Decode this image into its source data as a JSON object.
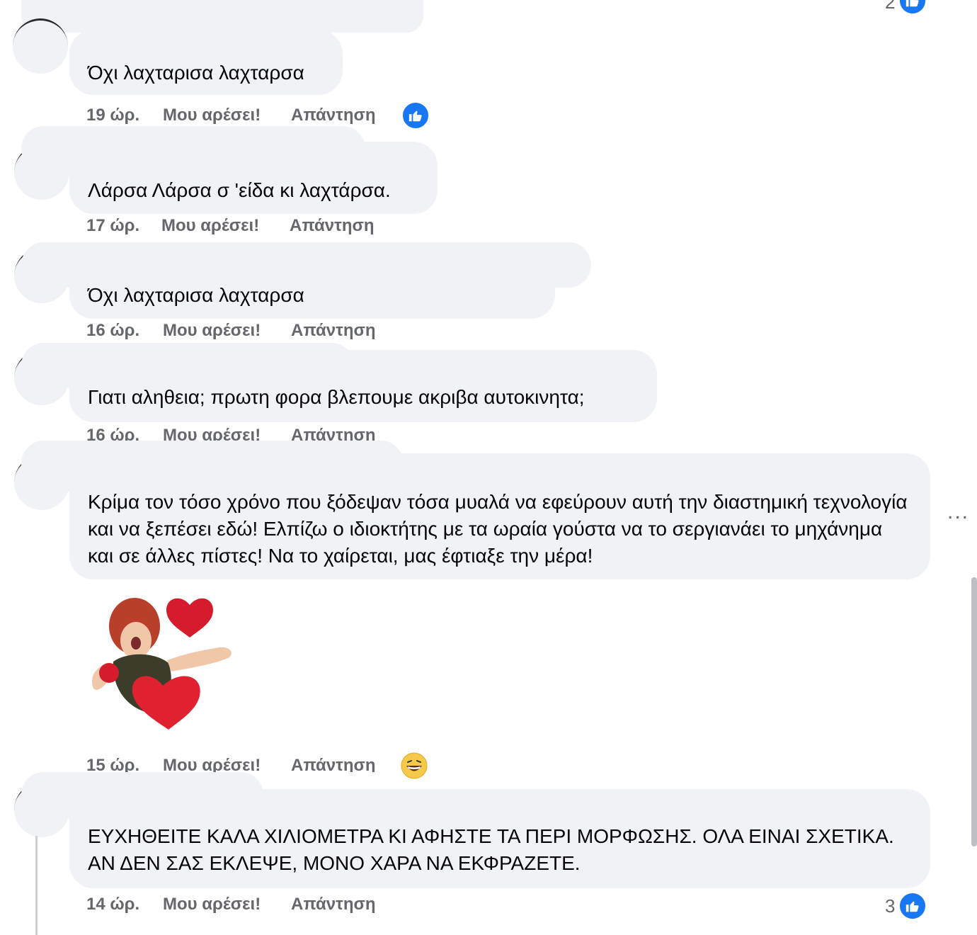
{
  "comments": [
    {
      "text": "Όχι λαχταρισα λαχταρσα",
      "time": "19 ώρ.",
      "like": "Μου αρέσει!",
      "reply": "Απάντηση"
    },
    {
      "text": "Λάρσα Λάρσα σ 'είδα κι λαχτάρσα.",
      "time": "17 ώρ.",
      "like": "Μου αρέσει!",
      "reply": "Απάντηση"
    },
    {
      "text": "Όχι λαχταρισα λαχταρσα",
      "time": "16 ώρ.",
      "like": "Μου αρέσει!",
      "reply": "Απάντηση"
    },
    {
      "text": "Γιατι αληθεια; πρωτη φορα βλεπουμε ακριβα αυτοκινητα;",
      "time": "16 ώρ.",
      "like": "Μου αρέσει!",
      "reply": "Απάντηση"
    },
    {
      "text": "Κρίμα τον τόσο χρόνο που ξόδεψαν τόσα μυαλά να εφεύρουν αυτή την διαστημική τεχνολογία και να ξεπέσει εδώ! Ελπίζω ο ιδιοκτήτης με τα ωραία γούστα να το σεργιανάει το μηχάνημα και σε άλλες πίστες! Να το χαίρεται, μας έφτιαξε την μέρα!",
      "time": "15 ώρ.",
      "like": "Μου αρέσει!",
      "reply": "Απάντηση"
    },
    {
      "text": "ΕΥΧΗΘΕΙΤΕ ΚΑΛΑ ΧΙΛΙΟΜΕΤΡΑ ΚΙ ΑΦΗΣΤΕ ΤΑ ΠΕΡΙ ΜΟΡΦΩΣΗΣ. ΟΛΑ ΕΙΝΑΙ ΣΧΕΤΙΚΑ. ΑΝ ΔΕΝ ΣΑΣ ΕΚΛΕΨΕ, ΜΟΝΟ ΧΑΡΑ ΝΑ ΕΚΦΡΑΖΕΤΕ.",
      "time": "14 ώρ.",
      "like": "Μου αρέσει!",
      "reply": "Απάντηση"
    }
  ],
  "top_reaction_count": "2",
  "last_reaction_count": "3",
  "more_label": "...",
  "colors": {
    "bubble": "#f0f2f5",
    "like_blue": "#1877f2",
    "meta_gray": "#65676b"
  },
  "icons": {
    "like": "thumbs-up-icon",
    "haha": "laughing-emoji-icon",
    "more": "more-options-icon"
  }
}
